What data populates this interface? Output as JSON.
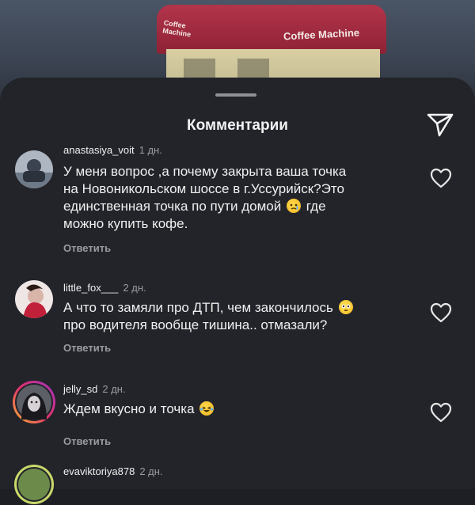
{
  "background": {
    "brand_large": "Coffee Machine",
    "brand_small_1": "Coffee",
    "brand_small_2": "Machine"
  },
  "sheet": {
    "title": "Комментарии",
    "send_icon": "send-paper-plane-icon"
  },
  "comments": [
    {
      "username": "anastasiya_voit",
      "time": "1 дн.",
      "text_1": "У меня вопрос ,а почему закрыта ваша точка",
      "text_2": "на Новоникольском шоссе в г.Уссурийск?Это",
      "text_3a": "единственная точка по пути домой",
      "text_3b": "где",
      "text_4": "можно купить кофе.",
      "emoji": "crying-face",
      "reply": "Ответить",
      "liked": false
    },
    {
      "username": "little_fox___",
      "time": "2 дн.",
      "text_1": "А что то замяли про ДТП, чем закончилось",
      "text_2": "про водителя вообще тишина.. отмазали?",
      "emoji": "flushed-face",
      "reply": "Ответить",
      "liked": false
    },
    {
      "username": "jelly_sd",
      "time": "2 дн.",
      "text_1": "Ждем вкусно и точка",
      "emoji": "laughing-tears-face",
      "reply": "Ответить",
      "liked": false
    },
    {
      "username": "evaviktoriya878",
      "time": "2 дн.",
      "reply": "",
      "liked": false
    }
  ]
}
